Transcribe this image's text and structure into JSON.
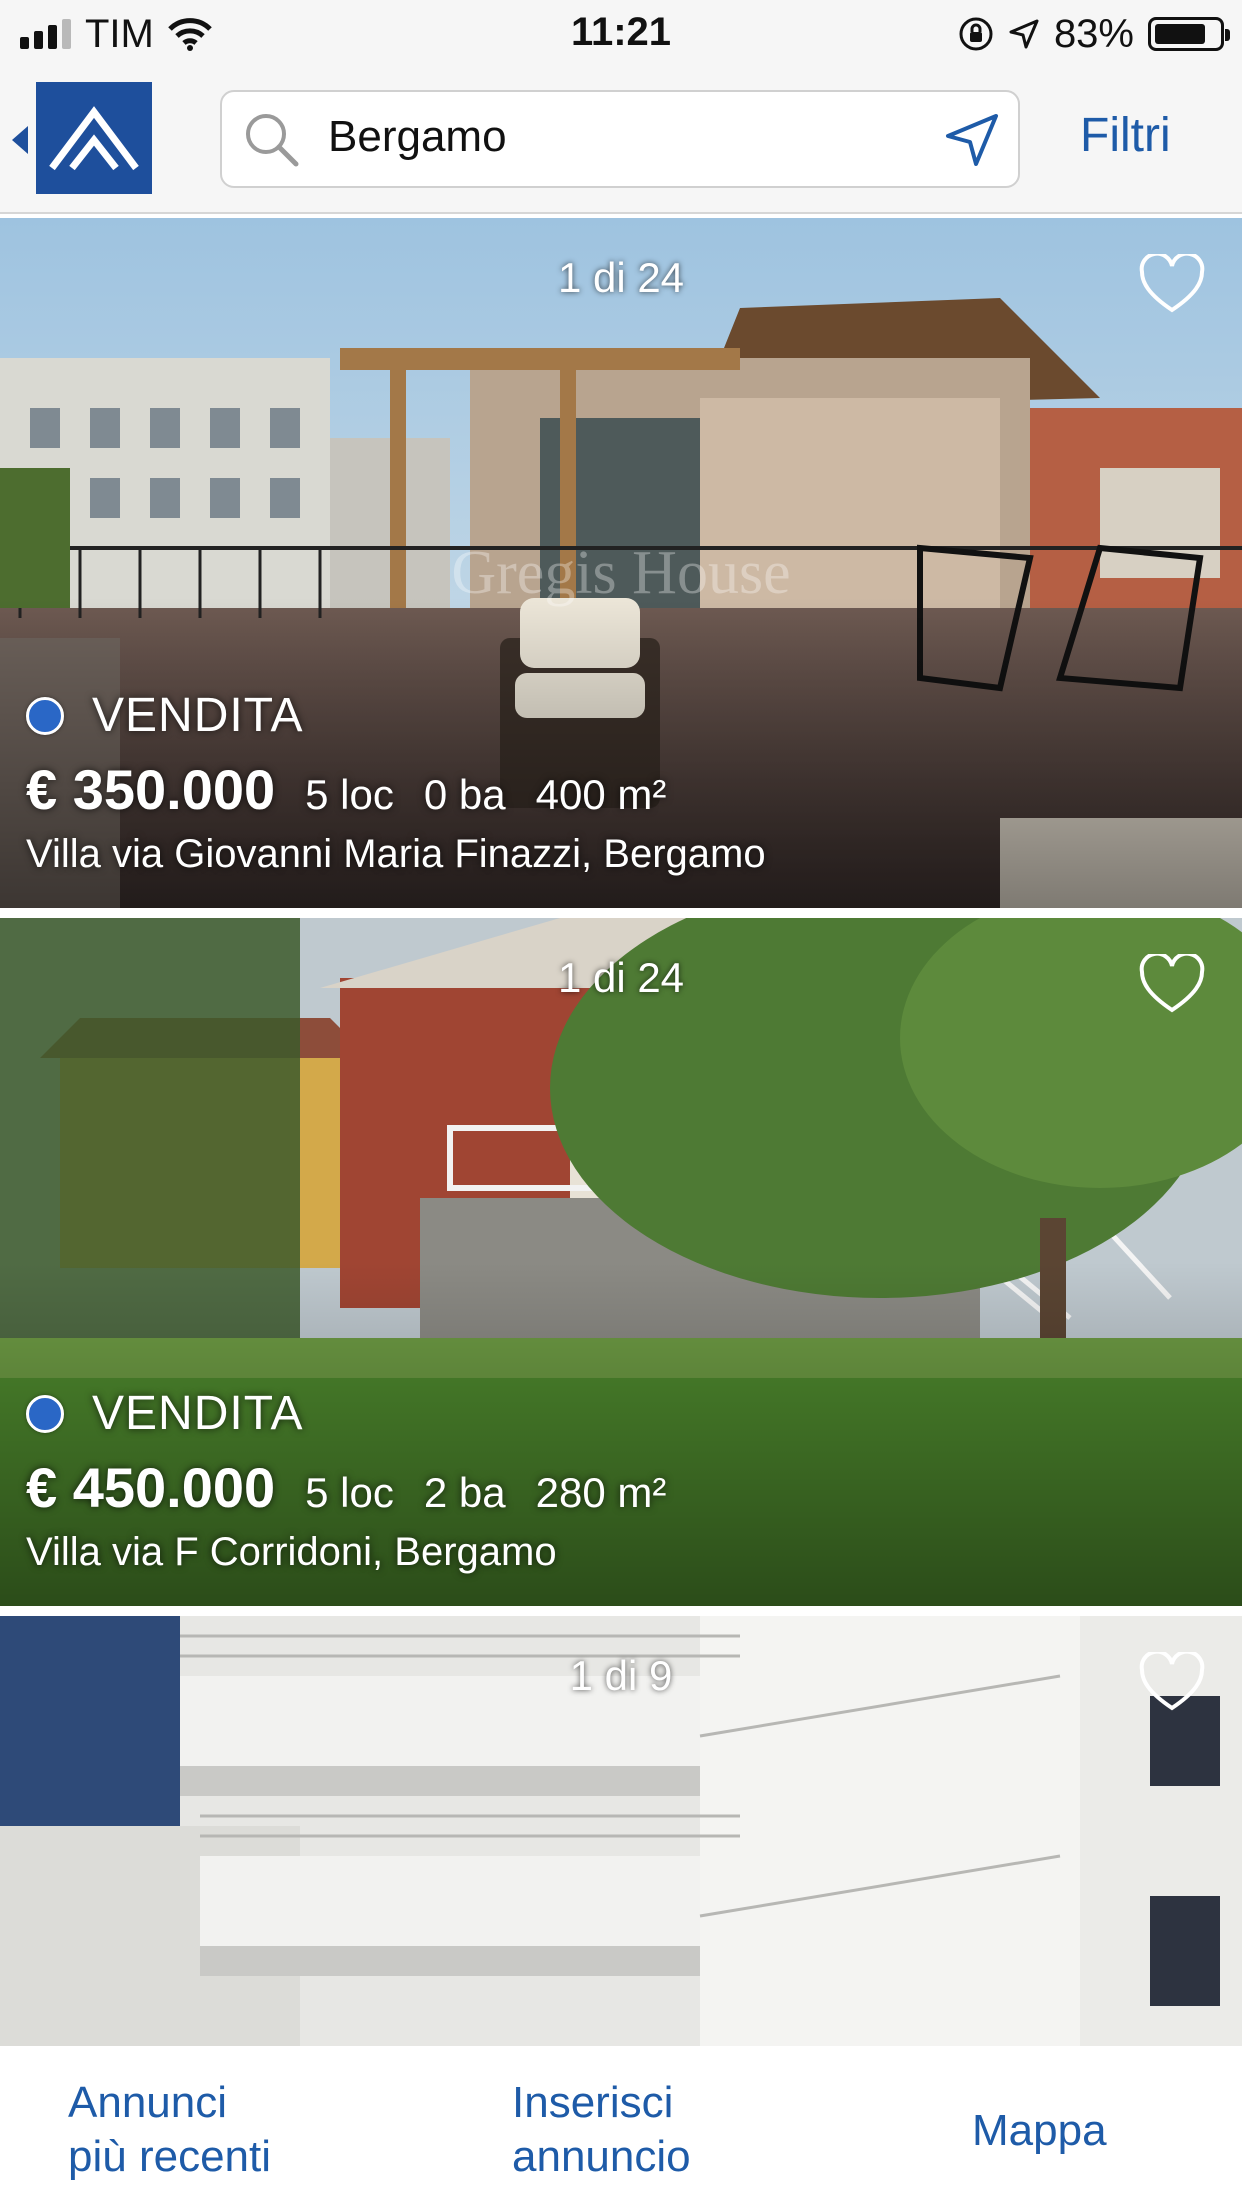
{
  "status_bar": {
    "carrier": "TIM",
    "time": "11:21",
    "battery": "83%",
    "battery_level": 0.83,
    "signal_icon": "cellular-signal-icon",
    "wifi_icon": "wifi-icon",
    "orientation_lock_icon": "orientation-lock-icon",
    "location_icon": "location-arrow-icon"
  },
  "nav": {
    "back_icon": "back-chevron-icon",
    "logo_icon": "house-roof-logo",
    "search": {
      "value": "Bergamo",
      "icon": "search-icon",
      "locate_icon": "locate-arrow-icon"
    },
    "filter_label": "Filtri"
  },
  "listings": [
    {
      "counter": "1 di 24",
      "watermark": "Gregis House",
      "tipo": "VENDITA",
      "price": "€ 350.000",
      "rooms": "5 loc",
      "baths": "0 ba",
      "area": "400 m²",
      "address": "Villa via Giovanni Maria Finazzi, Bergamo",
      "heart_icon": "heart-outline-icon"
    },
    {
      "counter": "1 di 24",
      "tipo": "VENDITA",
      "price": "€ 450.000",
      "rooms": "5 loc",
      "baths": "2 ba",
      "area": "280 m²",
      "address": "Villa via F Corridoni, Bergamo",
      "heart_icon": "heart-outline-icon"
    },
    {
      "counter": "1 di 9",
      "heart_icon": "heart-outline-icon"
    }
  ],
  "tabs": [
    {
      "line1": "Annunci",
      "line2": "più recenti"
    },
    {
      "line1": "Inserisci",
      "line2": "annuncio"
    },
    {
      "label": "Mappa"
    }
  ],
  "colors": {
    "accent": "#1e5ba8",
    "logo_bg": "#1e4f9c",
    "status_dot": "#2a67c6"
  }
}
